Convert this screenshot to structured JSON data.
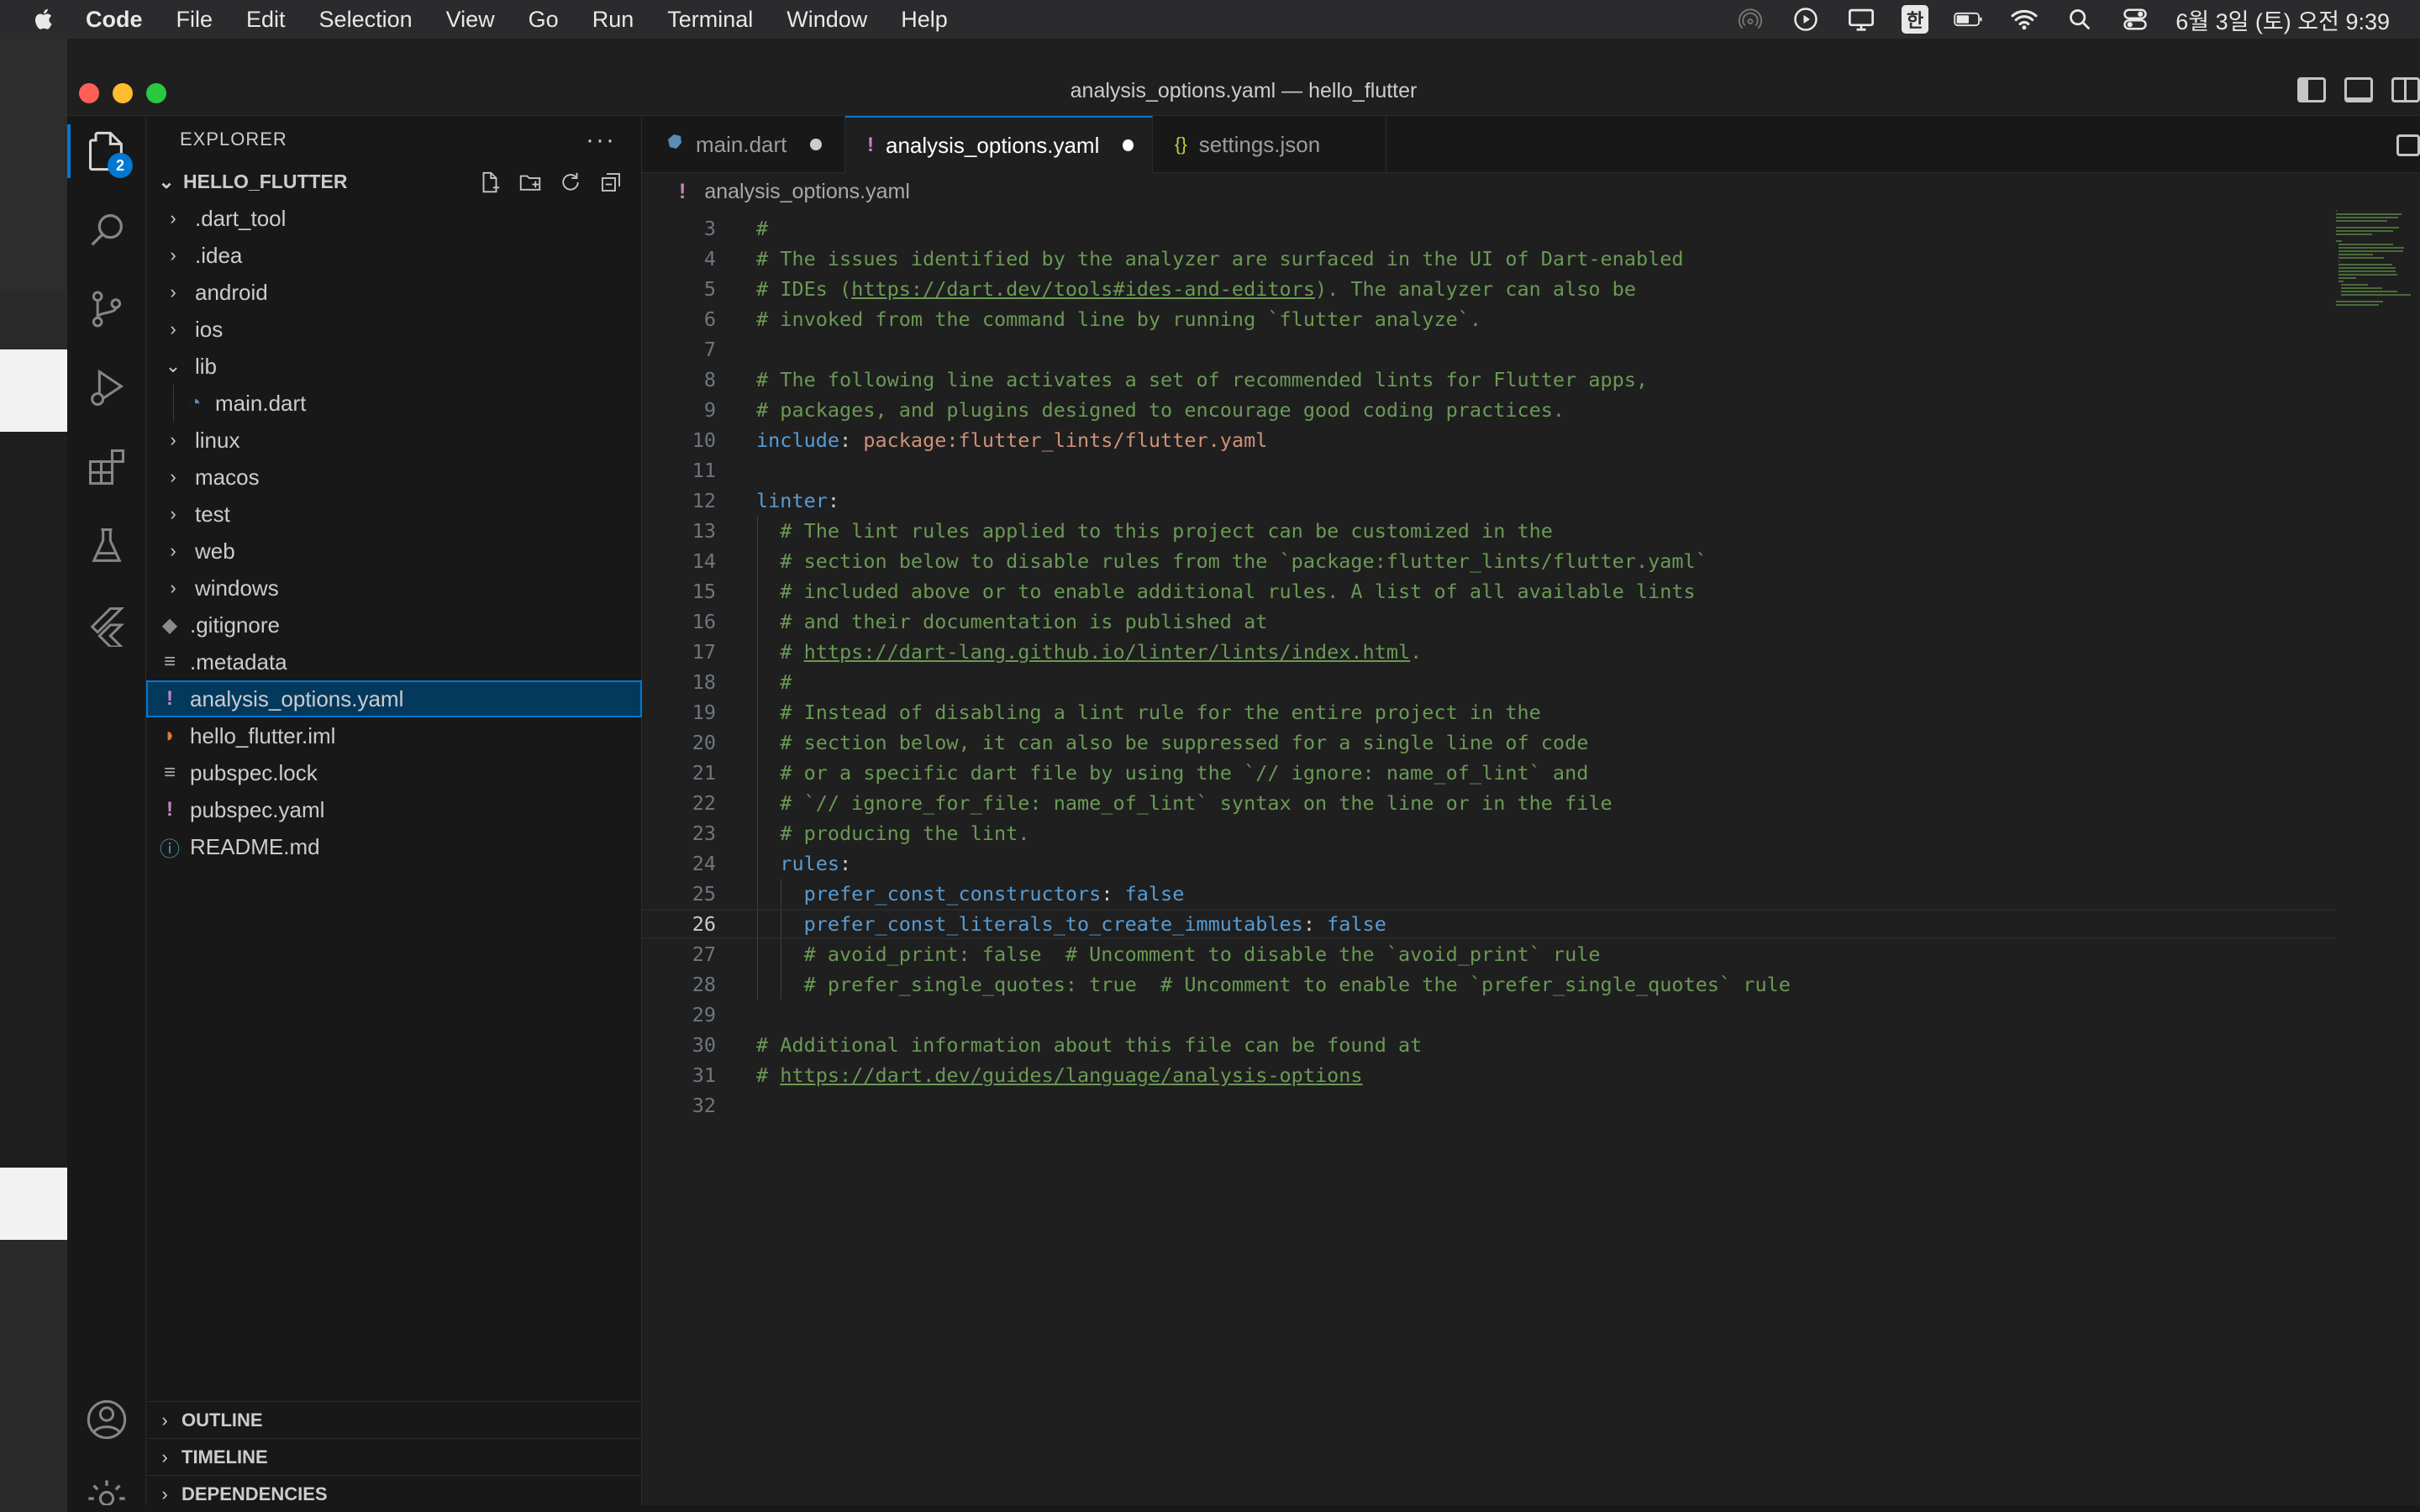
{
  "menubar": {
    "app": "Code",
    "items": [
      "File",
      "Edit",
      "Selection",
      "View",
      "Go",
      "Run",
      "Terminal",
      "Window",
      "Help"
    ],
    "ime": "한",
    "clock": "6월 3일 (토) 오전 9:39"
  },
  "window": {
    "title": "analysis_options.yaml — hello_flutter"
  },
  "activitybar": {
    "explorer_badge": "2"
  },
  "sidebar": {
    "title": "EXPLORER",
    "folder": "HELLO_FLUTTER",
    "tree": [
      {
        "label": ".dart_tool",
        "type": "folder",
        "expanded": false
      },
      {
        "label": ".idea",
        "type": "folder",
        "expanded": false
      },
      {
        "label": "android",
        "type": "folder",
        "expanded": false
      },
      {
        "label": "ios",
        "type": "folder",
        "expanded": false
      },
      {
        "label": "lib",
        "type": "folder",
        "expanded": true
      },
      {
        "label": "main.dart",
        "type": "dart",
        "child": true
      },
      {
        "label": "linux",
        "type": "folder",
        "expanded": false
      },
      {
        "label": "macos",
        "type": "folder",
        "expanded": false
      },
      {
        "label": "test",
        "type": "folder",
        "expanded": false
      },
      {
        "label": "web",
        "type": "folder",
        "expanded": false
      },
      {
        "label": "windows",
        "type": "folder",
        "expanded": false
      },
      {
        "label": ".gitignore",
        "type": "git"
      },
      {
        "label": ".metadata",
        "type": "lines"
      },
      {
        "label": "analysis_options.yaml",
        "type": "yaml",
        "selected": true
      },
      {
        "label": "hello_flutter.iml",
        "type": "rss"
      },
      {
        "label": "pubspec.lock",
        "type": "lines"
      },
      {
        "label": "pubspec.yaml",
        "type": "yaml"
      },
      {
        "label": "README.md",
        "type": "info"
      }
    ],
    "panels": [
      "OUTLINE",
      "TIMELINE",
      "DEPENDENCIES"
    ]
  },
  "tabs": [
    {
      "label": "main.dart",
      "icon": "dart-icon",
      "dirty": true,
      "active": false
    },
    {
      "label": "analysis_options.yaml",
      "icon": "yaml-icon",
      "dirty": true,
      "active": true
    },
    {
      "label": "settings.json",
      "icon": "json-icon",
      "dirty": false,
      "active": false
    }
  ],
  "breadcrumb": "analysis_options.yaml",
  "editor": {
    "current_line": 26,
    "lines": [
      {
        "n": "3",
        "indent": 0,
        "segs": [
          [
            "cm",
            "#"
          ]
        ]
      },
      {
        "n": "4",
        "indent": 0,
        "segs": [
          [
            "cm",
            "# The issues identified by the analyzer are surfaced in the UI of Dart-enabled"
          ]
        ]
      },
      {
        "n": "5",
        "indent": 0,
        "segs": [
          [
            "cm",
            "# IDEs ("
          ],
          [
            "cm link",
            "https://dart.dev/tools#ides-and-editors"
          ],
          [
            "cm",
            "). The analyzer can also be"
          ]
        ]
      },
      {
        "n": "6",
        "indent": 0,
        "segs": [
          [
            "cm",
            "# invoked from the command line by running `flutter analyze`."
          ]
        ]
      },
      {
        "n": "7",
        "indent": 0,
        "segs": []
      },
      {
        "n": "8",
        "indent": 0,
        "segs": [
          [
            "cm",
            "# The following line activates a set of recommended lints for Flutter apps,"
          ]
        ]
      },
      {
        "n": "9",
        "indent": 0,
        "segs": [
          [
            "cm",
            "# packages, and plugins designed to encourage good coding practices."
          ]
        ]
      },
      {
        "n": "10",
        "indent": 0,
        "segs": [
          [
            "key",
            "include"
          ],
          [
            "punct",
            ": "
          ],
          [
            "str",
            "package:flutter_lints/flutter.yaml"
          ]
        ]
      },
      {
        "n": "11",
        "indent": 0,
        "segs": []
      },
      {
        "n": "12",
        "indent": 0,
        "segs": [
          [
            "key",
            "linter"
          ],
          [
            "punct",
            ":"
          ]
        ]
      },
      {
        "n": "13",
        "indent": 1,
        "segs": [
          [
            "cm",
            "# The lint rules applied to this project can be customized in the"
          ]
        ]
      },
      {
        "n": "14",
        "indent": 1,
        "segs": [
          [
            "cm",
            "# section below to disable rules from the `package:flutter_lints/flutter.yaml`"
          ]
        ]
      },
      {
        "n": "15",
        "indent": 1,
        "segs": [
          [
            "cm",
            "# included above or to enable additional rules. A list of all available lints"
          ]
        ]
      },
      {
        "n": "16",
        "indent": 1,
        "segs": [
          [
            "cm",
            "# and their documentation is published at"
          ]
        ]
      },
      {
        "n": "17",
        "indent": 1,
        "segs": [
          [
            "cm",
            "# "
          ],
          [
            "cm link",
            "https://dart-lang.github.io/linter/lints/index.html"
          ],
          [
            "cm",
            "."
          ]
        ]
      },
      {
        "n": "18",
        "indent": 1,
        "segs": [
          [
            "cm",
            "#"
          ]
        ]
      },
      {
        "n": "19",
        "indent": 1,
        "segs": [
          [
            "cm",
            "# Instead of disabling a lint rule for the entire project in the"
          ]
        ]
      },
      {
        "n": "20",
        "indent": 1,
        "segs": [
          [
            "cm",
            "# section below, it can also be suppressed for a single line of code"
          ]
        ]
      },
      {
        "n": "21",
        "indent": 1,
        "segs": [
          [
            "cm",
            "# or a specific dart file by using the `// ignore: name_of_lint` and"
          ]
        ]
      },
      {
        "n": "22",
        "indent": 1,
        "segs": [
          [
            "cm",
            "# `// ignore_for_file: name_of_lint` syntax on the line or in the file"
          ]
        ]
      },
      {
        "n": "23",
        "indent": 1,
        "segs": [
          [
            "cm",
            "# producing the lint."
          ]
        ]
      },
      {
        "n": "24",
        "indent": 1,
        "segs": [
          [
            "key",
            "rules"
          ],
          [
            "punct",
            ":"
          ]
        ]
      },
      {
        "n": "25",
        "indent": 2,
        "segs": [
          [
            "key",
            "prefer_const_constructors"
          ],
          [
            "punct",
            ": "
          ],
          [
            "bool",
            "false"
          ]
        ]
      },
      {
        "n": "26",
        "indent": 2,
        "segs": [
          [
            "key",
            "prefer_const_literals_to_create_immutables"
          ],
          [
            "punct",
            ": "
          ],
          [
            "bool",
            "false"
          ]
        ]
      },
      {
        "n": "27",
        "indent": 2,
        "segs": [
          [
            "cm",
            "# avoid_print: false  # Uncomment to disable the `avoid_print` rule"
          ]
        ]
      },
      {
        "n": "28",
        "indent": 2,
        "segs": [
          [
            "cm",
            "# prefer_single_quotes: true  # Uncomment to enable the `prefer_single_quotes` rule"
          ]
        ]
      },
      {
        "n": "29",
        "indent": 0,
        "segs": []
      },
      {
        "n": "30",
        "indent": 0,
        "segs": [
          [
            "cm",
            "# Additional information about this file can be found at"
          ]
        ]
      },
      {
        "n": "31",
        "indent": 0,
        "segs": [
          [
            "cm",
            "# "
          ],
          [
            "cm link",
            "https://dart.dev/guides/language/analysis-options"
          ]
        ]
      },
      {
        "n": "32",
        "indent": 0,
        "segs": []
      }
    ]
  },
  "colors": {
    "accent": "#0078d4",
    "comment": "#6a9955",
    "key": "#569cd6",
    "string": "#ce9178",
    "yaml_icon": "#c586c0"
  }
}
